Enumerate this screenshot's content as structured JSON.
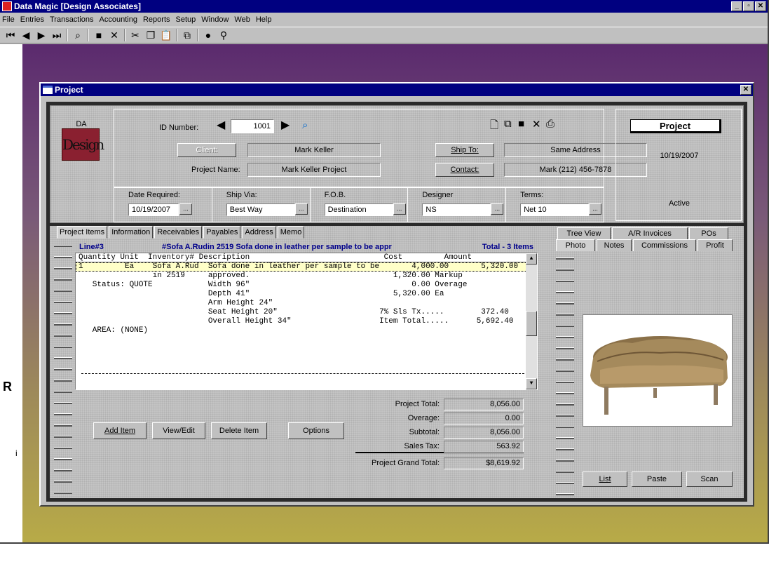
{
  "app": {
    "title": "Data Magic  [Design Associates]"
  },
  "menu": [
    "File",
    "Entries",
    "Transactions",
    "Accounting",
    "Reports",
    "Setup",
    "Window",
    "Web",
    "Help"
  ],
  "left_strip": {
    "letter": "R",
    "small": "i"
  },
  "project_window": {
    "title": "Project",
    "logo": {
      "top": "DA",
      "word": "Design"
    },
    "id_label": "ID Number:",
    "id_value": "1001",
    "client_button": "Client:",
    "client_value": "Mark Keller",
    "project_name_label": "Project Name:",
    "project_name_value": "Mark Keller Project",
    "ship_to_button": "Ship To:",
    "ship_to_value": "Same Address",
    "contact_button": "Contact:",
    "contact_value": "Mark (212) 456-7878",
    "sub": [
      {
        "label": "Date Required:",
        "value": "10/19/2007"
      },
      {
        "label": "Ship Via:",
        "value": "Best Way"
      },
      {
        "label": "F.O.B.",
        "value": "Destination"
      },
      {
        "label": "Designer",
        "value": "NS"
      },
      {
        "label": "Terms:",
        "value": "Net 10"
      }
    ],
    "status_panel": {
      "title": "Project",
      "date": "10/19/2007",
      "status": "Active"
    }
  },
  "left_tabs": [
    "Project Items",
    "Information",
    "Receivables",
    "Payables",
    "Address",
    "Memo"
  ],
  "line_header": {
    "line": "Line#3",
    "desc": "#Sofa A.Rudin 2519 Sofa done in leather per sample to be appr",
    "total": "Total - 3 Items"
  },
  "grid": {
    "header": "Quantity Unit  Inventory# Description                             Cost         Amount",
    "rows": [
      "1         Ea    Sofa A.Rud  Sofa done in leather per sample to be       4,000.00       5,320.00",
      "                in 2519     approved.                               1,320.00 Markup",
      "   Status: QUOTE            Width 96\"                                   0.00 Overage",
      "                            Depth 41\"                               5,320.00 Ea",
      "                            Arm Height 24\"",
      "                            Seat Height 20\"                      7% Sls Tx.....        372.40",
      "                            Overall Height 34\"                   Item Total.....      5,692.40",
      "   AREA: (NONE)"
    ]
  },
  "actions": [
    "Add Item",
    "View/Edit",
    "Delete Item",
    "Options"
  ],
  "totals": [
    {
      "label": "Project Total:",
      "value": "8,056.00"
    },
    {
      "label": "Overage:",
      "value": "0.00"
    },
    {
      "label": "Subtotal:",
      "value": "8,056.00"
    },
    {
      "label": "Sales Tax:",
      "value": "563.92"
    },
    {
      "label": "Project Grand Total:",
      "value": "$8,619.92"
    }
  ],
  "right_tabs_top": [
    "Tree View",
    "A/R Invoices",
    "POs"
  ],
  "right_tabs_bottom": [
    "Photo",
    "Notes",
    "Commissions",
    "Profit"
  ],
  "photo_buttons": [
    "List",
    "Paste",
    "Scan"
  ],
  "colors": {
    "title_bar": "#000080",
    "line_header_text": "#00008b"
  }
}
